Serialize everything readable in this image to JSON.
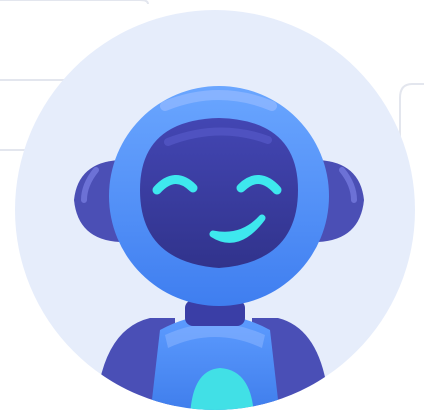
{
  "avatar": {
    "name": "robot-assistant",
    "expression": "smiling"
  },
  "colors": {
    "page_background": "#ffffff",
    "circle_background": "#e6edfb",
    "frame_line": "#e3e6ee",
    "body_light": "#4f8ff5",
    "body_mid": "#3f7ef0",
    "head_shell": "#5590f3",
    "face_plate": "#3a3ea6",
    "face_plate_dark": "#33358f",
    "ears": "#4b4fb5",
    "shoulders": "#4a4fb6",
    "face_glow": "#3ee8ee",
    "chest_screen": "#41e0e6",
    "highlight": "#8fb7ff"
  }
}
